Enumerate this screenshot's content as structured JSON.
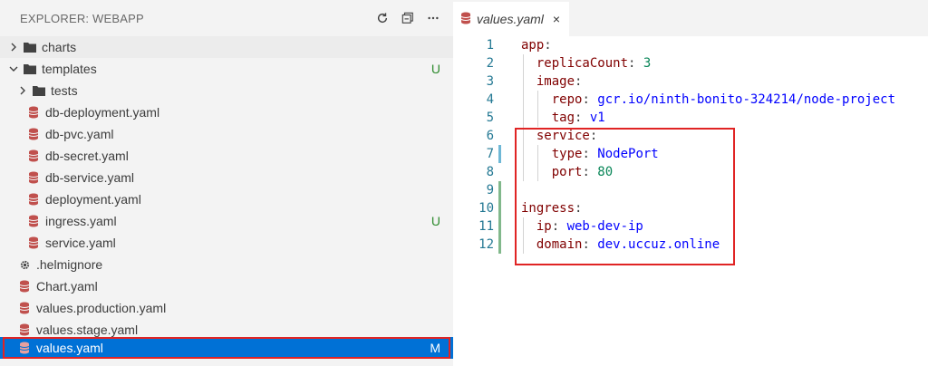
{
  "explorer": {
    "title": "EXPLORER: WEBAPP",
    "actions": [
      "refresh-icon",
      "collapse-all-icon",
      "more-icon"
    ],
    "items": [
      {
        "label": "charts",
        "kind": "folder",
        "expanded": false,
        "badge": ""
      },
      {
        "label": "templates",
        "kind": "folder",
        "expanded": true,
        "badge": "U"
      },
      {
        "label": "tests",
        "kind": "folder",
        "expanded": false,
        "badge": ""
      },
      {
        "label": "db-deployment.yaml",
        "kind": "yaml",
        "badge": ""
      },
      {
        "label": "db-pvc.yaml",
        "kind": "yaml",
        "badge": ""
      },
      {
        "label": "db-secret.yaml",
        "kind": "yaml",
        "badge": ""
      },
      {
        "label": "db-service.yaml",
        "kind": "yaml",
        "badge": ""
      },
      {
        "label": "deployment.yaml",
        "kind": "yaml",
        "badge": ""
      },
      {
        "label": "ingress.yaml",
        "kind": "yaml",
        "badge": "U"
      },
      {
        "label": "service.yaml",
        "kind": "yaml",
        "badge": ""
      },
      {
        "label": ".helmignore",
        "kind": "settings",
        "badge": ""
      },
      {
        "label": "Chart.yaml",
        "kind": "yaml",
        "badge": ""
      },
      {
        "label": "values.production.yaml",
        "kind": "yaml",
        "badge": ""
      },
      {
        "label": "values.stage.yaml",
        "kind": "yaml",
        "badge": ""
      },
      {
        "label": "values.yaml",
        "kind": "yaml",
        "badge": "M",
        "selected": true
      }
    ]
  },
  "editor": {
    "tab": {
      "label": "values.yaml",
      "close": "×"
    },
    "lines": [
      {
        "n": "1",
        "key": "app",
        "val": "",
        "type": ""
      },
      {
        "n": "2",
        "key": "replicaCount",
        "val": "3",
        "type": "num"
      },
      {
        "n": "3",
        "key": "image",
        "val": "",
        "type": ""
      },
      {
        "n": "4",
        "key": "repo",
        "val": "gcr.io/ninth-bonito-324214/node-project",
        "type": "str"
      },
      {
        "n": "5",
        "key": "tag",
        "val": "v1",
        "type": "str"
      },
      {
        "n": "6",
        "key": "service",
        "val": "",
        "type": ""
      },
      {
        "n": "7",
        "key": "type",
        "val": "NodePort",
        "type": "str"
      },
      {
        "n": "8",
        "key": "port",
        "val": "80",
        "type": "num"
      },
      {
        "n": "9",
        "key": "",
        "val": "",
        "type": ""
      },
      {
        "n": "10",
        "key": "ingress",
        "val": "",
        "type": ""
      },
      {
        "n": "11",
        "key": "ip",
        "val": "web-dev-ip",
        "type": "str"
      },
      {
        "n": "12",
        "key": "domain",
        "val": "dev.uccuz.online",
        "type": "str"
      }
    ]
  },
  "colors": {
    "accent": "#0071d6",
    "untracked": "#2d8a2d",
    "highlight": "#e02424",
    "yaml_icon": "#c0504d"
  }
}
